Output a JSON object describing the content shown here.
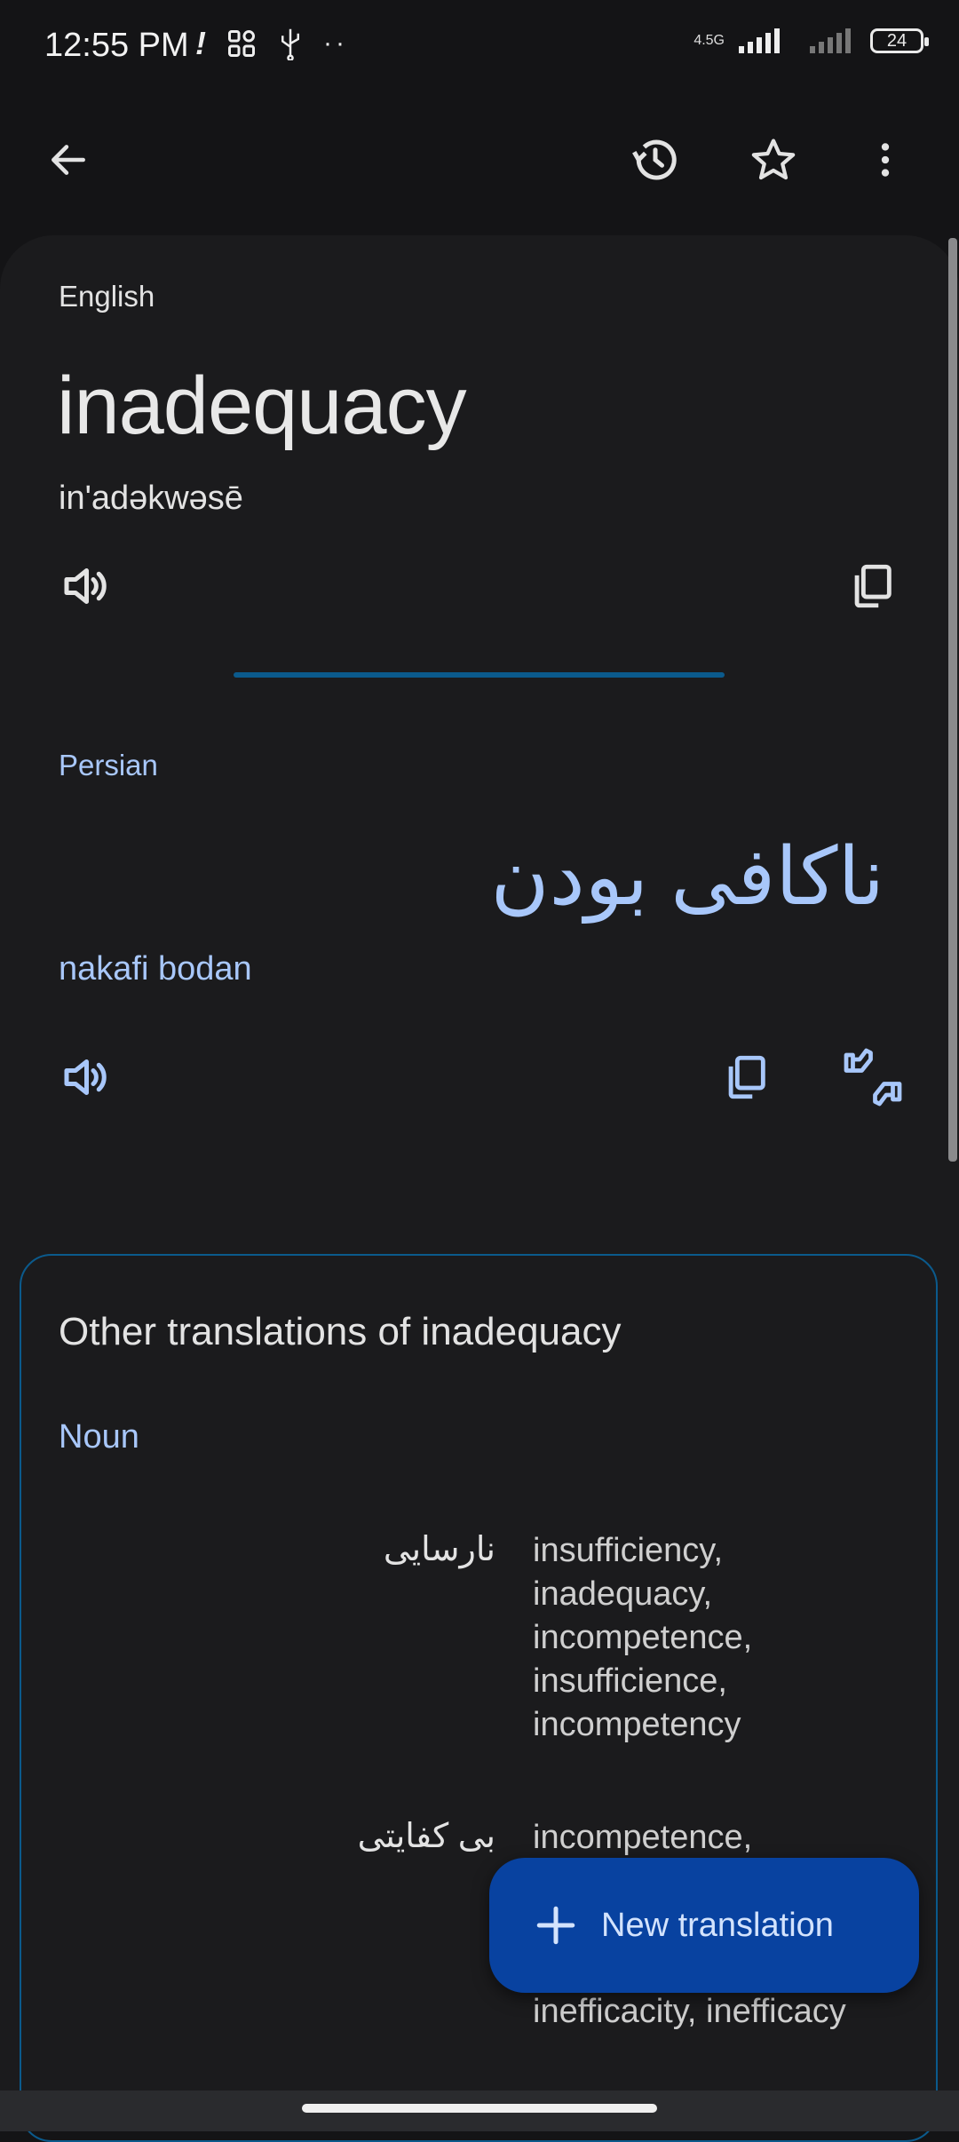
{
  "status_bar": {
    "time": "12:55 PM",
    "network_label": "4.5G",
    "battery": "24"
  },
  "toolbar": {
    "back": "back-icon",
    "history": "history-icon",
    "favorite": "star-icon",
    "more": "more-vert-icon"
  },
  "source": {
    "language": "English",
    "text": "inadequacy",
    "phonetic": "in'adəkwəsē"
  },
  "target": {
    "language": "Persian",
    "text": "ناکافی بودن",
    "transliteration": "nakafi bodan"
  },
  "other_translations": {
    "title": "Other translations of inadequacy",
    "part_of_speech": "Noun",
    "rows": [
      {
        "persian": "نارسایی",
        "english": "insufficiency, inadequacy, incompetence, insufficience, incompetency"
      },
      {
        "persian": "بی کفایتی",
        "english": "incompetence,"
      },
      {
        "persian": "",
        "english": "inefficacity, inefficacy"
      }
    ]
  },
  "fab": {
    "label": "New translation"
  },
  "colors": {
    "background": "#141416",
    "accent_text": "#a8c7fa",
    "fab": "#0842a0",
    "card_border": "#0b5a8c"
  }
}
